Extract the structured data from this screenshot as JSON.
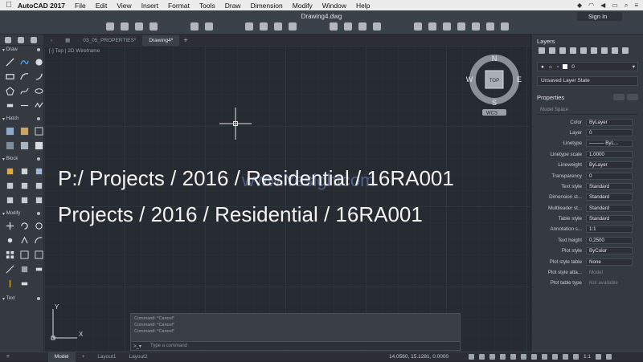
{
  "menubar": {
    "app_name": "AutoCAD 2017",
    "items": [
      "File",
      "Edit",
      "View",
      "Insert",
      "Format",
      "Tools",
      "Draw",
      "Dimension",
      "Modify",
      "Window",
      "Help"
    ]
  },
  "window": {
    "title": "Drawing4.dwg",
    "sign_in": "Sign In"
  },
  "tabs": [
    "03_05_PROPERTIES*",
    "Drawing4*"
  ],
  "viewport": {
    "label": "[-] Top | 2D Wireframe",
    "compass": {
      "n": "N",
      "s": "S",
      "e": "E",
      "w": "W",
      "top": "TOP",
      "wcs": "WCS"
    }
  },
  "tool_sections": [
    "Draw",
    "Hatch",
    "Block",
    "Modify",
    "Text"
  ],
  "overlay": {
    "line1": "P:/ Projects / 2016 / Residential / 16RA001",
    "line2": "Projects / 2016 / Residential / 16RA001",
    "watermark": "www.Yesightcom"
  },
  "ucs": {
    "x": "X",
    "y": "Y"
  },
  "command": {
    "history": [
      "Command: *Cancel*",
      "Command: *Cancel*",
      "Command: *Cancel*"
    ],
    "placeholder": "Type a command"
  },
  "status": {
    "tabs": [
      "Model",
      "Layout1",
      "Layout2"
    ],
    "coords": "14.0560, 15.1281, 0.0000",
    "scale": "1:1"
  },
  "layers_panel": {
    "title": "Layers",
    "current_layer": "0",
    "layer_state": "Unsaved Layer State"
  },
  "properties_panel": {
    "title": "Properties",
    "space": "Model Space",
    "rows": [
      {
        "label": "Color",
        "value": "ByLayer"
      },
      {
        "label": "Layer",
        "value": "0"
      },
      {
        "label": "Linetype",
        "value": "——— ByL..."
      },
      {
        "label": "Linetype scale",
        "value": "1.0000"
      },
      {
        "label": "Lineweight",
        "value": "ByLayer"
      },
      {
        "label": "Transparency",
        "value": "0"
      },
      {
        "label": "Text style",
        "value": "Standard"
      },
      {
        "label": "Dimension st...",
        "value": "Standard"
      },
      {
        "label": "Multileader st...",
        "value": "Standard"
      },
      {
        "label": "Table style",
        "value": "Standard"
      },
      {
        "label": "Annotation s...",
        "value": "1:1"
      },
      {
        "label": "Text height",
        "value": "0.2500"
      },
      {
        "label": "Plot style",
        "value": "ByColor"
      },
      {
        "label": "Plot style table",
        "value": "None"
      },
      {
        "label": "Plot style atta...",
        "value": "Model"
      },
      {
        "label": "Plot table type",
        "value": "Not available"
      }
    ]
  }
}
